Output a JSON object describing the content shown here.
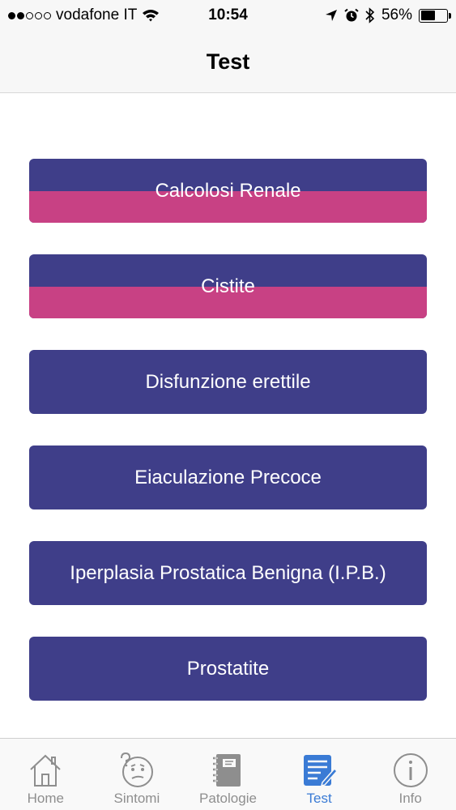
{
  "status_bar": {
    "carrier": "vodafone IT",
    "time": "10:54",
    "battery_percent": "56%",
    "battery_level": 0.56,
    "signal_full": 2,
    "signal_empty": 3
  },
  "nav": {
    "title": "Test"
  },
  "colors": {
    "primary": "#3f3e89",
    "accent": "#c84184",
    "tab_active": "#3a7bd5",
    "tab_inactive": "#8e8e8e"
  },
  "tests": [
    {
      "label": "Calcolosi Renale",
      "progress": 0.5
    },
    {
      "label": "Cistite",
      "progress": 0.5
    },
    {
      "label": "Disfunzione erettile",
      "progress": 0
    },
    {
      "label": "Eiaculazione Precoce",
      "progress": 0
    },
    {
      "label": "Iperplasia Prostatica Benigna (I.P.B.)",
      "progress": 0
    },
    {
      "label": "Prostatite",
      "progress": 0
    }
  ],
  "tabs": [
    {
      "label": "Home",
      "icon": "home-icon",
      "active": false
    },
    {
      "label": "Sintomi",
      "icon": "confused-face-icon",
      "active": false
    },
    {
      "label": "Patologie",
      "icon": "notebook-icon",
      "active": false
    },
    {
      "label": "Test",
      "icon": "checklist-icon",
      "active": true
    },
    {
      "label": "Info",
      "icon": "info-icon",
      "active": false
    }
  ]
}
